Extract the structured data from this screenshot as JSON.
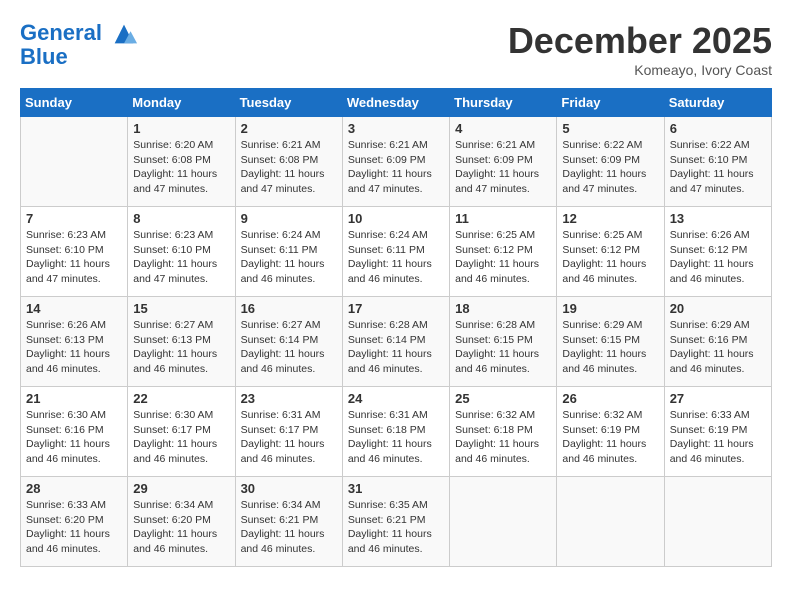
{
  "header": {
    "logo_line1": "General",
    "logo_line2": "Blue",
    "month": "December 2025",
    "location": "Komeayo, Ivory Coast"
  },
  "weekdays": [
    "Sunday",
    "Monday",
    "Tuesday",
    "Wednesday",
    "Thursday",
    "Friday",
    "Saturday"
  ],
  "weeks": [
    [
      {
        "day": "",
        "sunrise": "",
        "sunset": "",
        "daylight": ""
      },
      {
        "day": "1",
        "sunrise": "Sunrise: 6:20 AM",
        "sunset": "Sunset: 6:08 PM",
        "daylight": "Daylight: 11 hours and 47 minutes."
      },
      {
        "day": "2",
        "sunrise": "Sunrise: 6:21 AM",
        "sunset": "Sunset: 6:08 PM",
        "daylight": "Daylight: 11 hours and 47 minutes."
      },
      {
        "day": "3",
        "sunrise": "Sunrise: 6:21 AM",
        "sunset": "Sunset: 6:09 PM",
        "daylight": "Daylight: 11 hours and 47 minutes."
      },
      {
        "day": "4",
        "sunrise": "Sunrise: 6:21 AM",
        "sunset": "Sunset: 6:09 PM",
        "daylight": "Daylight: 11 hours and 47 minutes."
      },
      {
        "day": "5",
        "sunrise": "Sunrise: 6:22 AM",
        "sunset": "Sunset: 6:09 PM",
        "daylight": "Daylight: 11 hours and 47 minutes."
      },
      {
        "day": "6",
        "sunrise": "Sunrise: 6:22 AM",
        "sunset": "Sunset: 6:10 PM",
        "daylight": "Daylight: 11 hours and 47 minutes."
      }
    ],
    [
      {
        "day": "7",
        "sunrise": "Sunrise: 6:23 AM",
        "sunset": "Sunset: 6:10 PM",
        "daylight": "Daylight: 11 hours and 47 minutes."
      },
      {
        "day": "8",
        "sunrise": "Sunrise: 6:23 AM",
        "sunset": "Sunset: 6:10 PM",
        "daylight": "Daylight: 11 hours and 47 minutes."
      },
      {
        "day": "9",
        "sunrise": "Sunrise: 6:24 AM",
        "sunset": "Sunset: 6:11 PM",
        "daylight": "Daylight: 11 hours and 46 minutes."
      },
      {
        "day": "10",
        "sunrise": "Sunrise: 6:24 AM",
        "sunset": "Sunset: 6:11 PM",
        "daylight": "Daylight: 11 hours and 46 minutes."
      },
      {
        "day": "11",
        "sunrise": "Sunrise: 6:25 AM",
        "sunset": "Sunset: 6:12 PM",
        "daylight": "Daylight: 11 hours and 46 minutes."
      },
      {
        "day": "12",
        "sunrise": "Sunrise: 6:25 AM",
        "sunset": "Sunset: 6:12 PM",
        "daylight": "Daylight: 11 hours and 46 minutes."
      },
      {
        "day": "13",
        "sunrise": "Sunrise: 6:26 AM",
        "sunset": "Sunset: 6:12 PM",
        "daylight": "Daylight: 11 hours and 46 minutes."
      }
    ],
    [
      {
        "day": "14",
        "sunrise": "Sunrise: 6:26 AM",
        "sunset": "Sunset: 6:13 PM",
        "daylight": "Daylight: 11 hours and 46 minutes."
      },
      {
        "day": "15",
        "sunrise": "Sunrise: 6:27 AM",
        "sunset": "Sunset: 6:13 PM",
        "daylight": "Daylight: 11 hours and 46 minutes."
      },
      {
        "day": "16",
        "sunrise": "Sunrise: 6:27 AM",
        "sunset": "Sunset: 6:14 PM",
        "daylight": "Daylight: 11 hours and 46 minutes."
      },
      {
        "day": "17",
        "sunrise": "Sunrise: 6:28 AM",
        "sunset": "Sunset: 6:14 PM",
        "daylight": "Daylight: 11 hours and 46 minutes."
      },
      {
        "day": "18",
        "sunrise": "Sunrise: 6:28 AM",
        "sunset": "Sunset: 6:15 PM",
        "daylight": "Daylight: 11 hours and 46 minutes."
      },
      {
        "day": "19",
        "sunrise": "Sunrise: 6:29 AM",
        "sunset": "Sunset: 6:15 PM",
        "daylight": "Daylight: 11 hours and 46 minutes."
      },
      {
        "day": "20",
        "sunrise": "Sunrise: 6:29 AM",
        "sunset": "Sunset: 6:16 PM",
        "daylight": "Daylight: 11 hours and 46 minutes."
      }
    ],
    [
      {
        "day": "21",
        "sunrise": "Sunrise: 6:30 AM",
        "sunset": "Sunset: 6:16 PM",
        "daylight": "Daylight: 11 hours and 46 minutes."
      },
      {
        "day": "22",
        "sunrise": "Sunrise: 6:30 AM",
        "sunset": "Sunset: 6:17 PM",
        "daylight": "Daylight: 11 hours and 46 minutes."
      },
      {
        "day": "23",
        "sunrise": "Sunrise: 6:31 AM",
        "sunset": "Sunset: 6:17 PM",
        "daylight": "Daylight: 11 hours and 46 minutes."
      },
      {
        "day": "24",
        "sunrise": "Sunrise: 6:31 AM",
        "sunset": "Sunset: 6:18 PM",
        "daylight": "Daylight: 11 hours and 46 minutes."
      },
      {
        "day": "25",
        "sunrise": "Sunrise: 6:32 AM",
        "sunset": "Sunset: 6:18 PM",
        "daylight": "Daylight: 11 hours and 46 minutes."
      },
      {
        "day": "26",
        "sunrise": "Sunrise: 6:32 AM",
        "sunset": "Sunset: 6:19 PM",
        "daylight": "Daylight: 11 hours and 46 minutes."
      },
      {
        "day": "27",
        "sunrise": "Sunrise: 6:33 AM",
        "sunset": "Sunset: 6:19 PM",
        "daylight": "Daylight: 11 hours and 46 minutes."
      }
    ],
    [
      {
        "day": "28",
        "sunrise": "Sunrise: 6:33 AM",
        "sunset": "Sunset: 6:20 PM",
        "daylight": "Daylight: 11 hours and 46 minutes."
      },
      {
        "day": "29",
        "sunrise": "Sunrise: 6:34 AM",
        "sunset": "Sunset: 6:20 PM",
        "daylight": "Daylight: 11 hours and 46 minutes."
      },
      {
        "day": "30",
        "sunrise": "Sunrise: 6:34 AM",
        "sunset": "Sunset: 6:21 PM",
        "daylight": "Daylight: 11 hours and 46 minutes."
      },
      {
        "day": "31",
        "sunrise": "Sunrise: 6:35 AM",
        "sunset": "Sunset: 6:21 PM",
        "daylight": "Daylight: 11 hours and 46 minutes."
      },
      {
        "day": "",
        "sunrise": "",
        "sunset": "",
        "daylight": ""
      },
      {
        "day": "",
        "sunrise": "",
        "sunset": "",
        "daylight": ""
      },
      {
        "day": "",
        "sunrise": "",
        "sunset": "",
        "daylight": ""
      }
    ]
  ]
}
